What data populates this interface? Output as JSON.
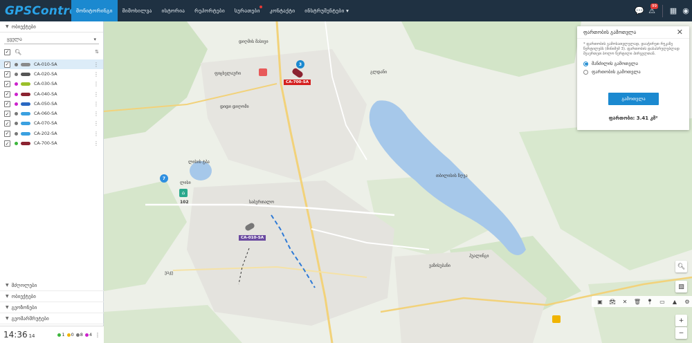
{
  "app": {
    "logo": "GPSControl"
  },
  "nav": [
    {
      "label": "მონიტორინგი",
      "active": true
    },
    {
      "label": "მიმოხილვა"
    },
    {
      "label": "ისტორია"
    },
    {
      "label": "რეპორტები"
    },
    {
      "label": "სურათები",
      "dot": true
    },
    {
      "label": "კონტაქტი"
    },
    {
      "label": "ინსტრუმენტები ▾"
    }
  ],
  "topright": {
    "notifications": "99"
  },
  "sidebar": {
    "objects_title": "ობიექტები",
    "group_select": "ყველა",
    "vehicles": [
      {
        "name": "CA-010-SA",
        "status": "#777777",
        "color": "#8a8a8a",
        "selected": true
      },
      {
        "name": "CA-020-SA",
        "status": "#777777",
        "color": "#555555"
      },
      {
        "name": "CA-030-SA",
        "status": "#cc22cc",
        "color": "#9bbf2a"
      },
      {
        "name": "CA-040-SA",
        "status": "#cc22cc",
        "color": "#8b2331"
      },
      {
        "name": "CA-050-SA",
        "status": "#cc22cc",
        "color": "#2a68c2"
      },
      {
        "name": "CA-060-SA",
        "status": "#777777",
        "color": "#3aa0e0"
      },
      {
        "name": "CA-070-SA",
        "status": "#777777",
        "color": "#3aa0e0"
      },
      {
        "name": "CA-202-SA",
        "status": "#777777",
        "color": "#3aa0e0"
      },
      {
        "name": "CA-700-SA",
        "status": "#3cb63c",
        "color": "#8b2331"
      }
    ],
    "bottom_sections": [
      "მძღოლები",
      "ობიექტები",
      "გეოზონები",
      "გეომარშრუტები"
    ]
  },
  "clock": {
    "time": "14:36",
    "seconds": "14"
  },
  "counts": [
    {
      "color": "#3cb63c",
      "value": "1"
    },
    {
      "color": "#f0b400",
      "value": "0"
    },
    {
      "color": "#777777",
      "value": "8"
    },
    {
      "color": "#cc22cc",
      "value": "4"
    }
  ],
  "panel": {
    "title": "ფართობის გამოთვლა",
    "note": "* ფართობის გამოსათვლელად, დააჭირეთ რუკაზე წერტილებს (მინიმუმ 3). ფართობის დასასრულებლად შეაერთეთ ბოლო წერტილი პირველთან.",
    "option1": "მანძილის გამოთვლა",
    "option2": "ფართობის გამოთვლა",
    "button": "გამოთვლა",
    "area_label": "ფართობი: 3.41 კმ²"
  },
  "map": {
    "labels": [
      "დიღმის მასივი",
      "ფიცხელაური",
      "ლისი",
      "ლისის ტბა",
      "დიდი დიღომი",
      "ვაკე",
      "საბურთალო",
      "თბილისის ზღვა",
      "ვაზისუბანი",
      "გლდანი",
      "ჰუალინგი"
    ],
    "plates": [
      "CA-700-SA",
      "CA-010-SA"
    ],
    "clusters": [
      "3",
      "7"
    ],
    "poi": [
      "102"
    ]
  }
}
